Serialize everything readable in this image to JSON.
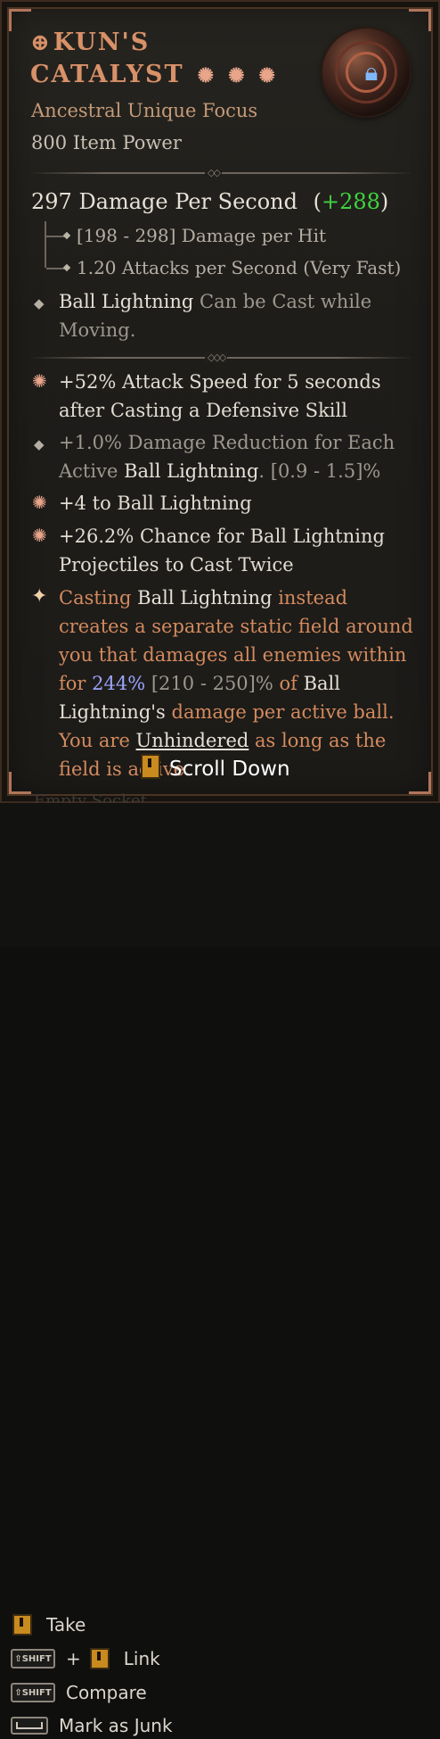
{
  "item": {
    "title_line1": "KUN'S",
    "title_rune": "⊕",
    "title_line2": "CATALYST",
    "stars": [
      "✺",
      "✺",
      "✺"
    ],
    "type": "Ancestral Unique Focus",
    "item_power": "800 Item Power",
    "locked_icon": "lock-icon"
  },
  "stats": {
    "dps_text": "297 Damage Per Second",
    "dps_open": "(",
    "dps_delta": "+288",
    "dps_close": ")",
    "damage_per_hit": "[198 - 298] Damage per Hit",
    "attacks_per_second": "1.20 Attacks per Second (Very Fast)"
  },
  "implicit": {
    "skill": "Ball Lightning",
    "rest": " Can be Cast while Moving."
  },
  "affixes": [
    {
      "icon": "✺",
      "text": "+52% Attack Speed for 5 seconds after Casting a Defensive Skill"
    },
    {
      "icon": "◆",
      "text_a": "+1.0% Damage Reduction for Each Active ",
      "skill": "Ball Lightning",
      "text_b": ". [0.9 - 1.5]%"
    },
    {
      "icon": "✺",
      "text": "+4 to Ball Lightning"
    },
    {
      "icon": "✺",
      "text": "+26.2% Chance for Ball Lightning Projectiles to Cast Twice"
    }
  ],
  "unique_power": {
    "icon": "✦",
    "p1": "Casting ",
    "skill1": "Ball Lightning",
    "p2": " instead creates a separate static field around you that damages all enemies within for ",
    "value": "244%",
    "range": " [210 - 250]%",
    "p3": " of ",
    "skill2": "Ball Lightning's",
    "p4": " damage per active ball. You are ",
    "keyword": "Unhindered",
    "p5": " as long as the field is active."
  },
  "scroll_hint": "Scroll Down",
  "ghost_text": "Empty Socket",
  "footer": {
    "take": "Take",
    "plus": "+",
    "link": "Link",
    "compare": "Compare",
    "junk": "Mark as Junk",
    "shift_key": "⇧SHIFT"
  },
  "colors": {
    "title": "#d89168",
    "delta_green": "#3fd13f",
    "value_blue": "#9da4ff",
    "unique_orange": "#d48a5e"
  }
}
